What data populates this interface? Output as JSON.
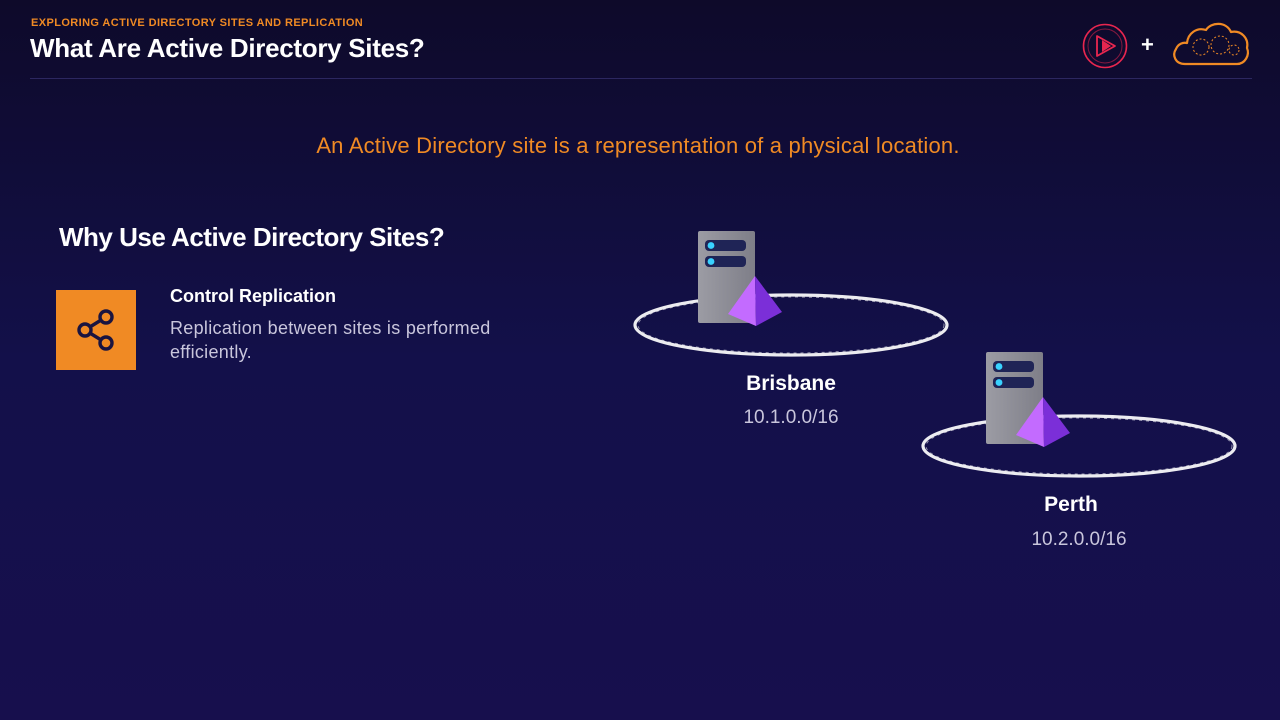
{
  "header": {
    "eyebrow": "EXPLORING ACTIVE DIRECTORY SITES AND REPLICATION",
    "title": "What Are Active Directory Sites?",
    "plus": "+"
  },
  "definition": "An Active Directory site is a representation of a physical location.",
  "why": {
    "heading": "Why Use Active Directory Sites?",
    "item_title": "Control Replication",
    "item_description": "Replication between sites is performed efficiently."
  },
  "sites": [
    {
      "name": "Brisbane",
      "subnet": "10.1.0.0/16"
    },
    {
      "name": "Perth",
      "subnet": "10.2.0.0/16"
    }
  ],
  "icons": {
    "play_logo": "play-logo-icon",
    "cloud_logo": "cloud-logo-icon",
    "share": "share-icon",
    "server": "server-icon"
  },
  "colors": {
    "accent": "#f08a24",
    "play_logo": "#e8264f",
    "background": "#130f45",
    "purple": "#8b3ff0"
  }
}
